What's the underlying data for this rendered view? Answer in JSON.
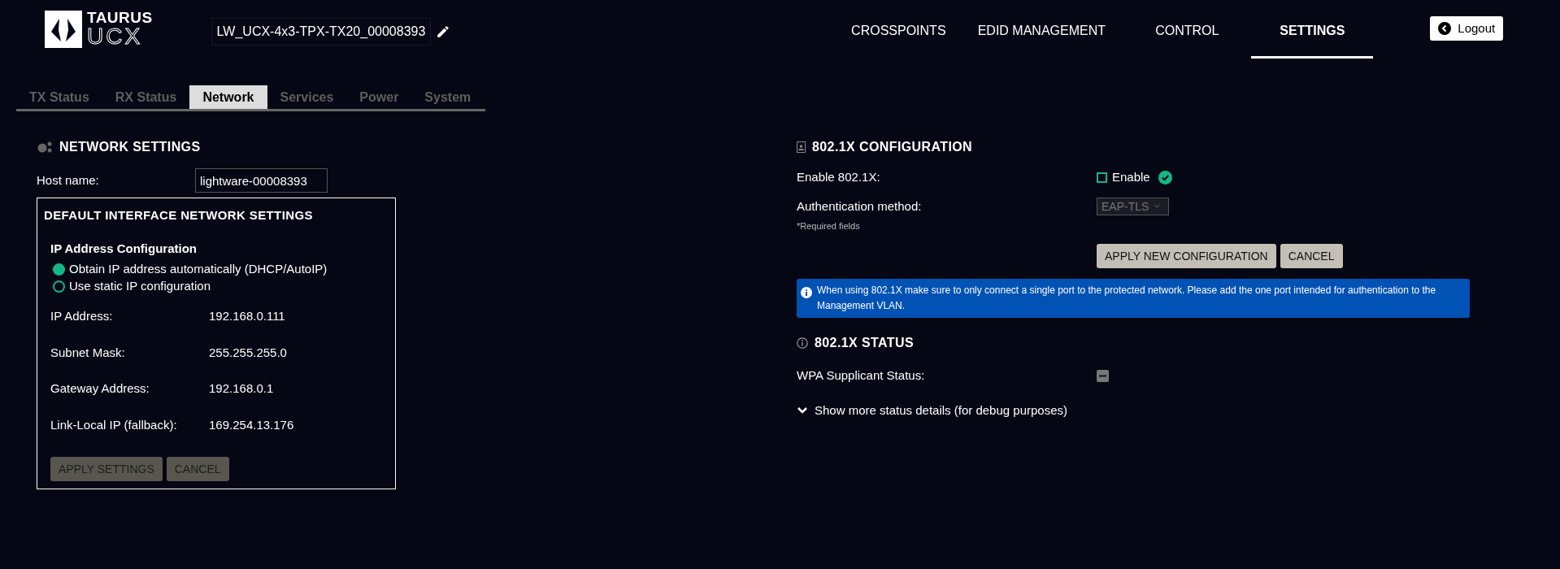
{
  "header": {
    "logo": {
      "line_1": "TAURUS",
      "line_2": "UCX"
    },
    "device_name": "LW_UCX-4x3-TPX-TX20_00008393"
  },
  "nav": [
    {
      "label": "CROSSPOINTS",
      "selected": false
    },
    {
      "label": "EDID MANAGEMENT",
      "selected": false
    },
    {
      "label": "CONTROL",
      "selected": false
    },
    {
      "label": "SETTINGS",
      "selected": true
    }
  ],
  "logout_button": "Logout",
  "tabs": [
    {
      "label": "TX Status",
      "selected": false
    },
    {
      "label": "RX Status",
      "selected": false
    },
    {
      "label": "Network",
      "selected": true
    },
    {
      "label": "Services",
      "selected": false
    },
    {
      "label": "Power",
      "selected": false
    },
    {
      "label": "System",
      "selected": false
    }
  ],
  "network_settings": {
    "title": "NETWORK SETTINGS",
    "host_name_label": "Host name:",
    "host_name_value": "lightware-00008393",
    "default_interface": {
      "title": "DEFAULT INTERFACE NETWORK SETTINGS",
      "ip_config_title": "IP Address Configuration",
      "options": [
        {
          "label": "Obtain IP address automatically (DHCP/AutoIP)",
          "selected": true
        },
        {
          "label": "Use static IP configuration",
          "selected": false
        }
      ],
      "fields": [
        {
          "label": "IP Address:",
          "value": "192.168.0.111"
        },
        {
          "label": "Subnet Mask:",
          "value": "255.255.255.0"
        },
        {
          "label": "Gateway Address:",
          "value": "192.168.0.1"
        },
        {
          "label": "Link-Local IP (fallback):",
          "value": "169.254.13.176"
        }
      ],
      "buttons": [
        {
          "label": "APPLY SETTINGS",
          "disabled": true
        },
        {
          "label": "CANCEL",
          "disabled": true
        }
      ]
    }
  },
  "dot1x_configuration": {
    "title": "802.1X CONFIGURATION",
    "enable_label": "Enable 802.1X:",
    "enable_checkbox": {
      "label": "Enable",
      "checked": false
    },
    "auth_method_label": "Authentication method:",
    "auth_method_value": "EAP-TLS",
    "required_note": "*Required fields",
    "buttons": [
      {
        "label": "APPLY NEW CONFIGURATION",
        "disabled": false
      },
      {
        "label": "CANCEL",
        "disabled": false
      }
    ],
    "info_message": "When using 802.1X make sure to only connect a single port to the protected network. Please add the one port intended for authentication to the Management VLAN."
  },
  "dot1x_status": {
    "title": "802.1X STATUS",
    "wpa_label": "WPA Supplicant Status:",
    "details_toggle": {
      "label": "Show more status details (for debug purposes)",
      "expanded": false
    }
  }
}
